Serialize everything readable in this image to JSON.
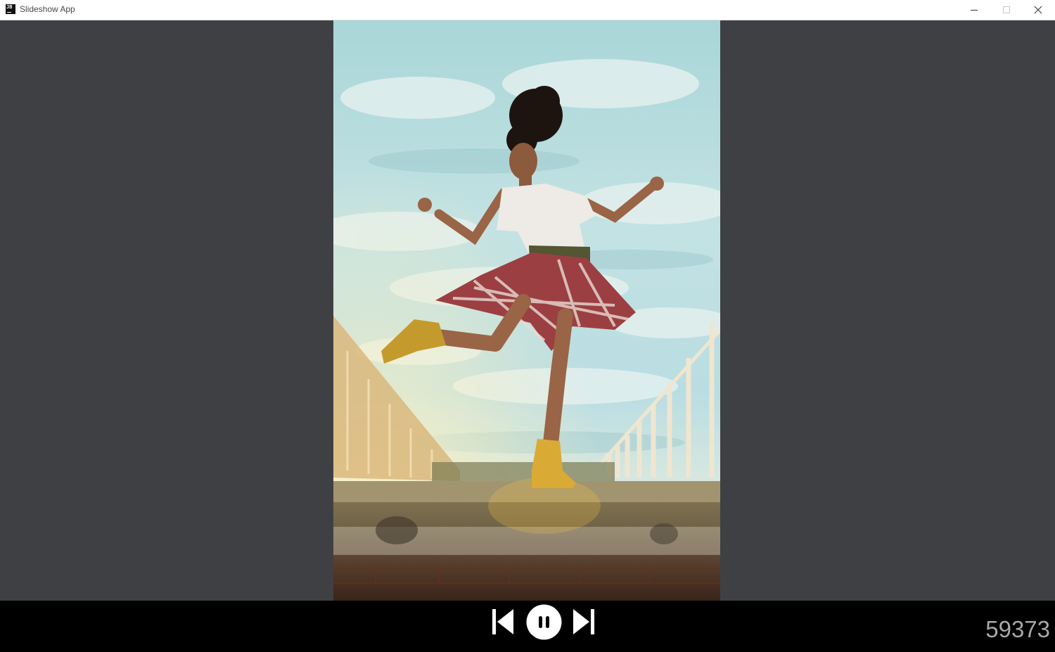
{
  "window": {
    "title": "Slideshow App",
    "app_icon_text": "JB",
    "controls": [
      "minimize-icon",
      "maximize-icon",
      "close-icon"
    ]
  },
  "slide": {
    "image_subject": "woman dancing on rooftop ledge against cloudy sky"
  },
  "playback": {
    "buttons": [
      "previous-icon",
      "pause-icon",
      "next-icon"
    ],
    "counter": "59373"
  },
  "colors": {
    "background": "#3f4043",
    "control_bar": "#000000",
    "titlebar": "#ffffff",
    "counter_text": "#a8a8a8"
  }
}
